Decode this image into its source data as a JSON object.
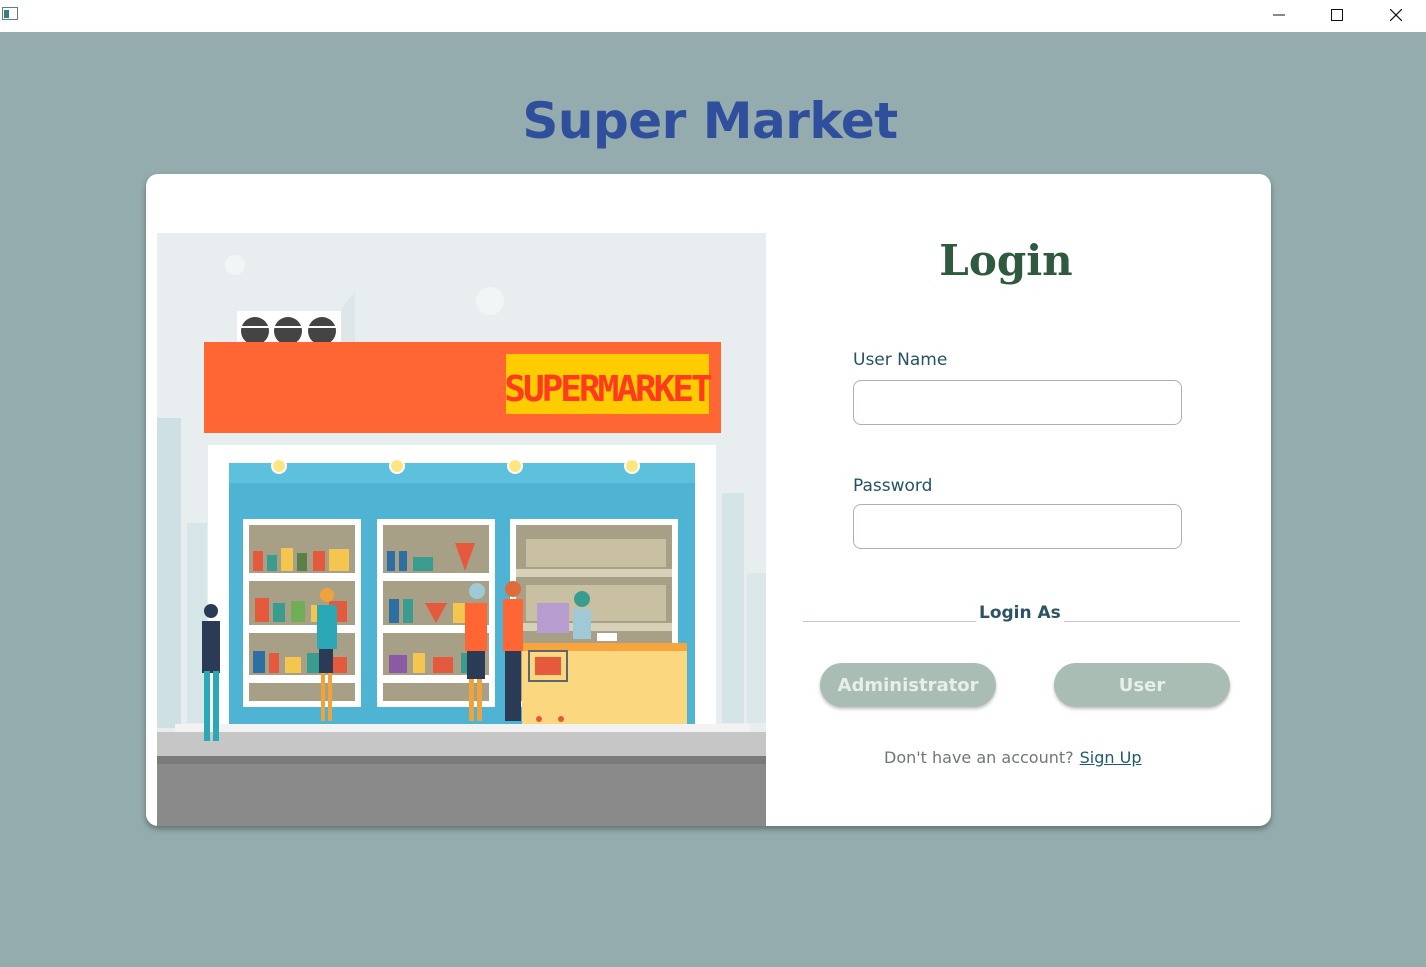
{
  "window": {
    "minimize_icon": "minimize-icon",
    "maximize_icon": "maximize-icon",
    "close_icon": "close-icon"
  },
  "app": {
    "title": "Super Market"
  },
  "illustration": {
    "sign_text": "SUPERMARKET"
  },
  "login": {
    "heading": "Login",
    "username_label": "User Name",
    "username_value": "",
    "password_label": "Password",
    "password_value": "",
    "login_as_label": "Login As",
    "admin_button": "Administrator",
    "user_button": "User",
    "signup_question": "Don't have an account?",
    "signup_link": "Sign Up"
  },
  "colors": {
    "background": "#94acad",
    "title": "#2f4f9c",
    "heading": "#2f5a3f",
    "button": "#a9bdb5",
    "sign_orange": "#ff6633",
    "sign_yellow": "#ffcc00"
  }
}
